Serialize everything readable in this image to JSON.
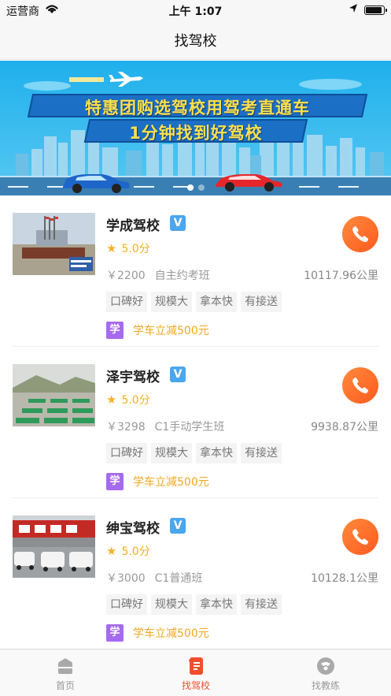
{
  "status_bar": {
    "carrier": "运营商",
    "time": "上午 1:07",
    "battery_level": 0.95
  },
  "nav": {
    "title": "找驾校"
  },
  "banner": {
    "line1": "特惠团购选驾校用驾考直通车",
    "line2": "1分钟找到好驾校",
    "slide_count": 2,
    "active_slide": 1
  },
  "schools": [
    {
      "name": "学成驾校",
      "verified_mark": "V",
      "rating": "5.0分",
      "price": "￥2200",
      "course": "自主约考班",
      "distance": "10117.96公里",
      "tags": [
        "口碑好",
        "规模大",
        "拿本快",
        "有接送"
      ],
      "promo_badge": "学",
      "promo_text": "学车立减500元"
    },
    {
      "name": "泽宇驾校",
      "verified_mark": "V",
      "rating": "5.0分",
      "price": "￥3298",
      "course": "C1手动学生班",
      "distance": "9938.87公里",
      "tags": [
        "口碑好",
        "规模大",
        "拿本快",
        "有接送"
      ],
      "promo_badge": "学",
      "promo_text": "学车立减500元"
    },
    {
      "name": "绅宝驾校",
      "verified_mark": "V",
      "rating": "5.0分",
      "price": "￥3000",
      "course": "C1普通班",
      "distance": "10128.1公里",
      "tags": [
        "口碑好",
        "规模大",
        "拿本快",
        "有接送"
      ],
      "promo_badge": "学",
      "promo_text": "学车立减500元"
    }
  ],
  "tab_bar": {
    "tabs": [
      {
        "label": "首页",
        "icon": "home-icon",
        "active": false
      },
      {
        "label": "找驾校",
        "icon": "school-icon",
        "active": true
      },
      {
        "label": "找教练",
        "icon": "coach-icon",
        "active": false
      }
    ]
  },
  "colors": {
    "accent": "#f24e2e",
    "star": "#f7b12c",
    "promo": "#f2a71e",
    "badge": "#a66af0",
    "verified": "#4aa6ee"
  }
}
